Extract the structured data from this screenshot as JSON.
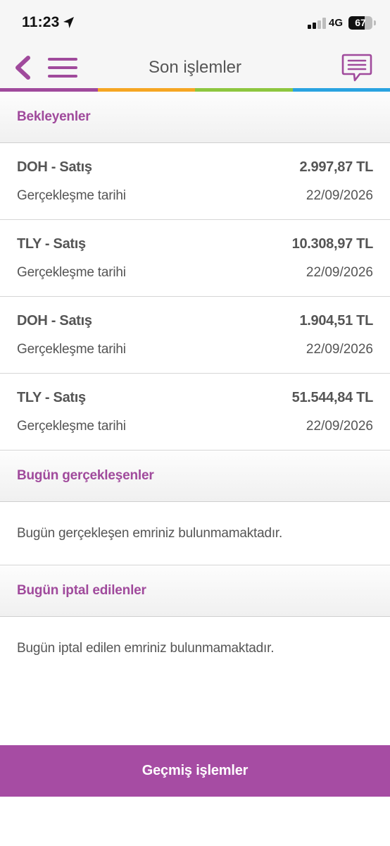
{
  "status_bar": {
    "time": "11:23",
    "network": "4G",
    "battery": "67",
    "battery_level": 0.67
  },
  "nav": {
    "title": "Son işlemler",
    "back_icon": "chevron-left-icon",
    "menu_icon": "hamburger-menu-icon",
    "chat_icon": "chat-bubble-icon"
  },
  "colors": {
    "brand": "#a04a9c",
    "strip": [
      "#a04a9c",
      "#f5a623",
      "#8dc63f",
      "#2aa3e0"
    ]
  },
  "sections": {
    "pending": {
      "title": "Bekleyenler",
      "orders": [
        {
          "title": "DOH - Satış",
          "amount": "2.997,87 TL",
          "label": "Gerçekleşme tarihi",
          "date": "22/09/2026"
        },
        {
          "title": "TLY - Satış",
          "amount": "10.308,97 TL",
          "label": "Gerçekleşme tarihi",
          "date": "22/09/2026"
        },
        {
          "title": "DOH - Satış",
          "amount": "1.904,51 TL",
          "label": "Gerçekleşme tarihi",
          "date": "22/09/2026"
        },
        {
          "title": "TLY - Satış",
          "amount": "51.544,84 TL",
          "label": "Gerçekleşme tarihi",
          "date": "22/09/2026"
        }
      ]
    },
    "completed_today": {
      "title": "Bugün gerçekleşenler",
      "empty_text": "Bugün gerçekleşen emriniz bulunmamaktadır."
    },
    "cancelled_today": {
      "title": "Bugün iptal edilenler",
      "empty_text": "Bugün iptal edilen emriniz bulunmamaktadır."
    }
  },
  "footer": {
    "history_label": "Geçmiş işlemler"
  }
}
